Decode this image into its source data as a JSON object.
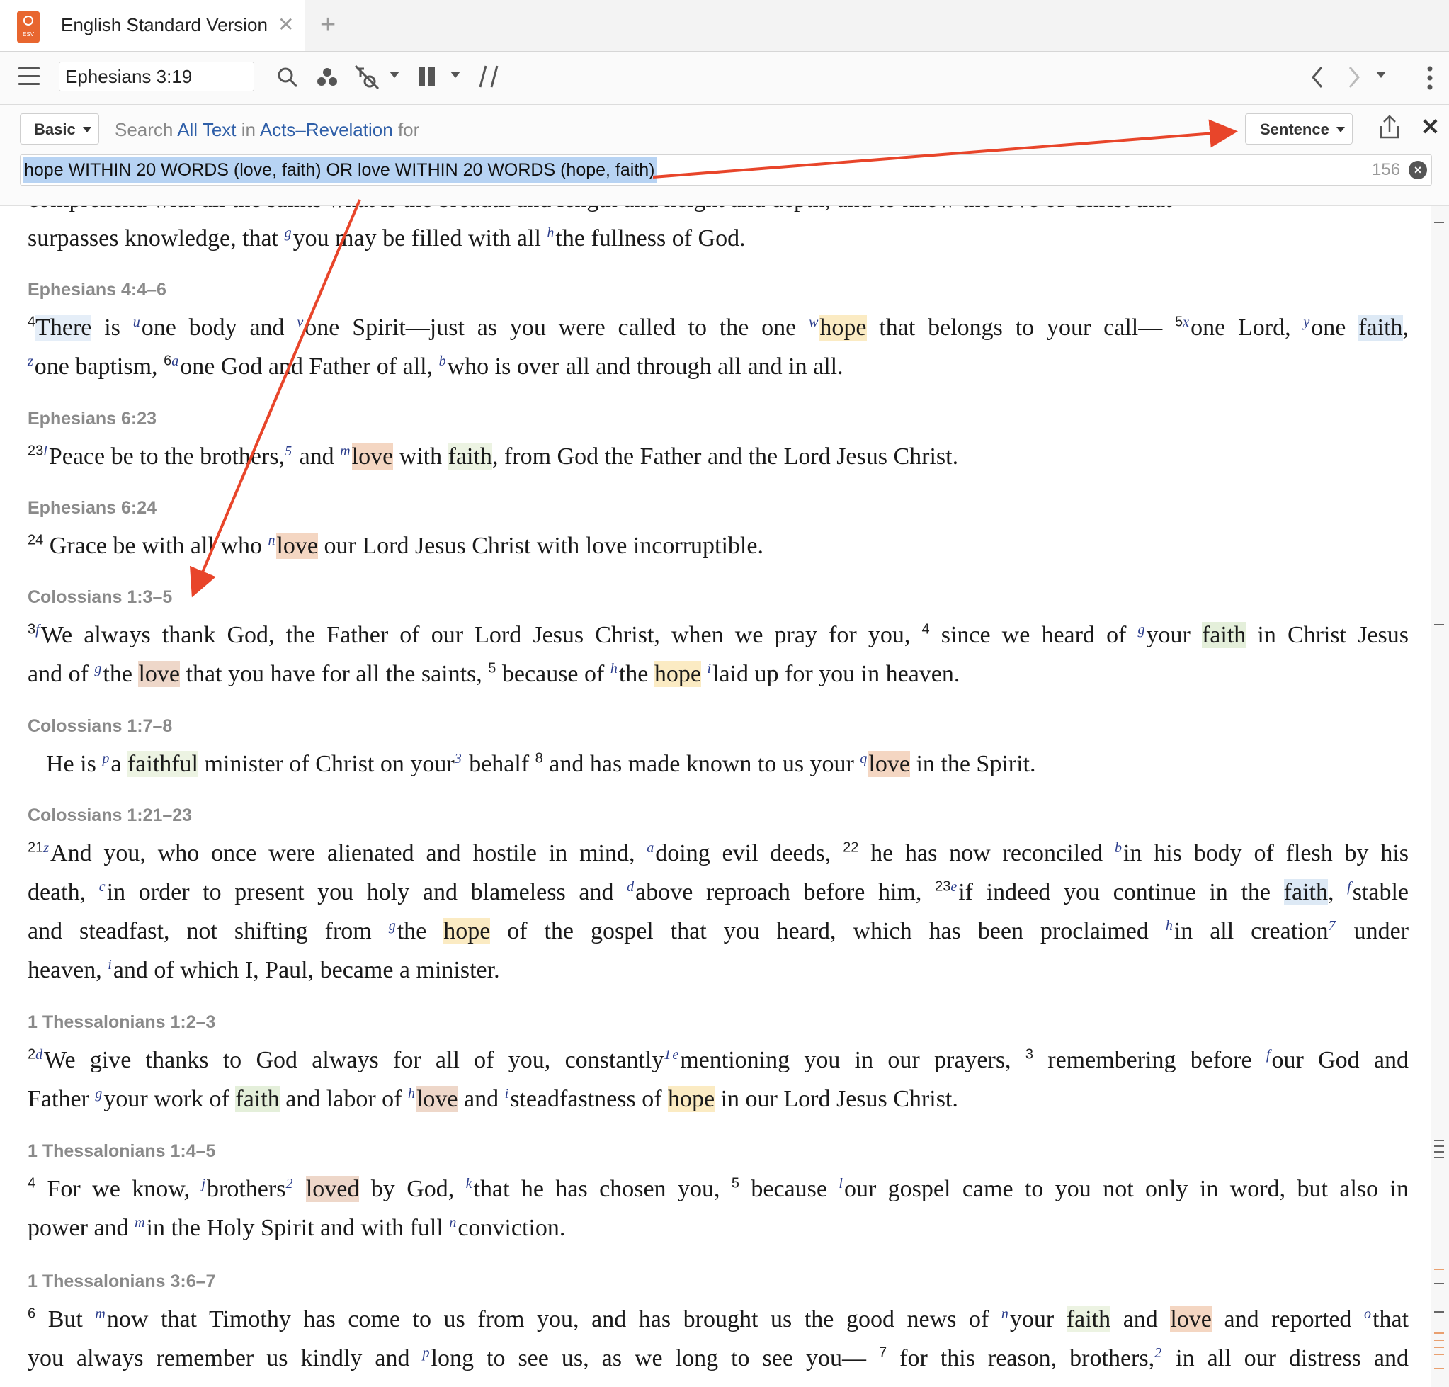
{
  "tab": {
    "title": "English Standard Version",
    "logo_label": "ESV"
  },
  "toolbar": {
    "reference": "Ephesians 3:19"
  },
  "search": {
    "mode": "Basic",
    "prefix": "Search",
    "scope_text": "All Text",
    "in_word": "in",
    "range": "Acts–Revelation",
    "for_word": "for",
    "match_unit": "Sentence",
    "query": "hope WITHIN 20 WORDS (love, faith) OR love WITHIN 20 WORDS (hope, faith)",
    "count": "156"
  },
  "colors": {
    "arrow": "#e8452a",
    "hope": "#fbebc3",
    "love": "#f4d6c2",
    "faith": "#e4efda",
    "link": "#2f5fa8"
  },
  "content": {
    "cutoff_line": "comprehend with all the saints what is the breadth and length and height and depth, and to know the love of Christ that",
    "intro": {
      "t1": "surpasses knowledge, that ",
      "fn1": "g",
      "t2": "you may be filled with all ",
      "fn2": "h",
      "t3": "the fullness of God."
    },
    "eph4": {
      "ref": "Ephesians 4:4–6",
      "l1": {
        "v": "4",
        "there": "There",
        "t1": " is ",
        "fn1": "u",
        "t2": "one body and ",
        "fn2": "v",
        "t3": "one Spirit—just as you were called to the one ",
        "fn3": "w",
        "hope": "hope",
        "t4": " that belongs to your call— ",
        "v5": "5",
        "fn4": "x",
        "t5": "one Lord, ",
        "fn5": "y",
        "t6": "one ",
        "faith": "faith",
        "t7": ","
      },
      "l2": {
        "fn1": "z",
        "t1": "one baptism, ",
        "v6": "6",
        "fn2": "a",
        "t2": "one God and Father of all, ",
        "fn3": "b",
        "t3": "who is over all and through all and in all."
      }
    },
    "eph623": {
      "ref": "Ephesians 6:23",
      "v": "23",
      "fn1": "l",
      "t1": "Peace be to the brothers,",
      "fn2": "5",
      "t2": " and ",
      "fn3": "m",
      "love": "love",
      "t3": " with ",
      "faith": "faith",
      "t4": ", from God the Father and the Lord Jesus Christ."
    },
    "eph624": {
      "ref": "Ephesians 6:24",
      "v": "24",
      "t1": " Grace be with all who ",
      "fn1": "n",
      "love": "love",
      "t2": " our Lord Jesus Christ with love incorruptible."
    },
    "col13": {
      "ref": "Colossians 1:3–5",
      "l1": {
        "v": "3",
        "fn1": "f",
        "t1": "We always thank God, the Father of our Lord Jesus Christ, when we pray for you, ",
        "v4": "4",
        "t2": " since we heard of ",
        "fn2": "g",
        "t3": "your ",
        "faith": "faith",
        "t4": " in Christ Jesus"
      },
      "l2": {
        "t1": "and of ",
        "fn1": "g",
        "t2": "the ",
        "love": "love",
        "t3": " that you have for all the saints, ",
        "v5": "5",
        "t4": " because of ",
        "fn2": "h",
        "t5": "the ",
        "hope": "hope",
        "t6": " ",
        "fn3": "i",
        "t7": "laid up for you in heaven."
      }
    },
    "col17": {
      "ref": "Colossians 1:7–8",
      "t1": "He is ",
      "fn1": "p",
      "t2": "a ",
      "faithful": "faithful",
      "t3": " minister of Christ on your",
      "fn2": "3",
      "t4": " behalf ",
      "v8": "8",
      "t5": " and has made known to us your ",
      "fn3": "q",
      "love": "love",
      "t6": " in the Spirit."
    },
    "col121": {
      "ref": "Colossians 1:21–23",
      "l1": {
        "v": "21",
        "fn1": "z",
        "t1": "And you, who once were alienated and hostile in mind, ",
        "fn2": "a",
        "t2": "doing evil deeds, ",
        "v22": "22",
        "t3": " he has now reconciled ",
        "fn3": "b",
        "t4": "in his body of flesh by his"
      },
      "l2": {
        "t1": "death, ",
        "fn1": "c",
        "t2": "in order to present you holy and blameless and ",
        "fn2": "d",
        "t3": "above reproach before him, ",
        "v23": "23",
        "fn3": "e",
        "t4": "if indeed you continue in the ",
        "faith": "faith",
        "t5": ", ",
        "fn4": "f",
        "t6": "stable"
      },
      "l3": {
        "t1": "and steadfast, not shifting from ",
        "fn1": "g",
        "t2": "the ",
        "hope": "hope",
        "t3": " of the gospel that you heard, which has been proclaimed ",
        "fn2": "h",
        "t4": "in all creation",
        "fn3": "7",
        "t5": " under"
      },
      "l4": {
        "t1": "heaven, ",
        "fn1": "i",
        "t2": "and of which I, Paul, became a minister."
      }
    },
    "th12": {
      "ref": "1 Thessalonians 1:2–3",
      "l1": {
        "v": "2",
        "fn1": "d",
        "t1": "We give thanks to God always for all of you, constantly",
        "fn2": "1",
        "fn3": "e",
        "t2": "mentioning you in our prayers, ",
        "v3": "3",
        "t3": " remembering before ",
        "fn4": "f",
        "t4": "our God and"
      },
      "l2": {
        "t1": "Father ",
        "fn1": "g",
        "t2": "your work of ",
        "faith": "faith",
        "t3": " and labor of ",
        "fn2": "h",
        "love": "love",
        "t4": " and ",
        "fn3": "i",
        "t5": "steadfastness of ",
        "hope": "hope",
        "t6": " in our Lord Jesus Christ."
      }
    },
    "th14": {
      "ref": "1 Thessalonians 1:4–5",
      "l1": {
        "v": "4",
        "t1": " For we know, ",
        "fn1": "j",
        "t2": "brothers",
        "fn2": "2",
        "t3": " ",
        "loved": "loved",
        "t4": " by God, ",
        "fn3": "k",
        "t5": "that he has chosen you, ",
        "v5": "5",
        "t6": " because ",
        "fn4": "l",
        "t7": "our gospel came to you not only in word, but also in"
      },
      "l2": {
        "t1": "power and ",
        "fn1": "m",
        "t2": "in the Holy Spirit and with full ",
        "fn2": "n",
        "t3": "conviction."
      }
    },
    "th36": {
      "ref": "1 Thessalonians 3:6–7",
      "l1": {
        "v": "6",
        "t1": " But ",
        "fn1": "m",
        "t2": "now that Timothy has come to us from you, and has brought us the good news of ",
        "fn2": "n",
        "t3": "your ",
        "faith": "faith",
        "t4": " and ",
        "love": "love",
        "t5": " and reported ",
        "fn3": "o",
        "t6": "that"
      },
      "l2": {
        "t1": "you always remember us kindly and ",
        "fn1": "p",
        "t2": "long to see us, as we long to see you— ",
        "v7": "7",
        "t3": " for this reason, brothers,",
        "fn2": "2",
        "t4": " in all our distress and"
      }
    }
  }
}
